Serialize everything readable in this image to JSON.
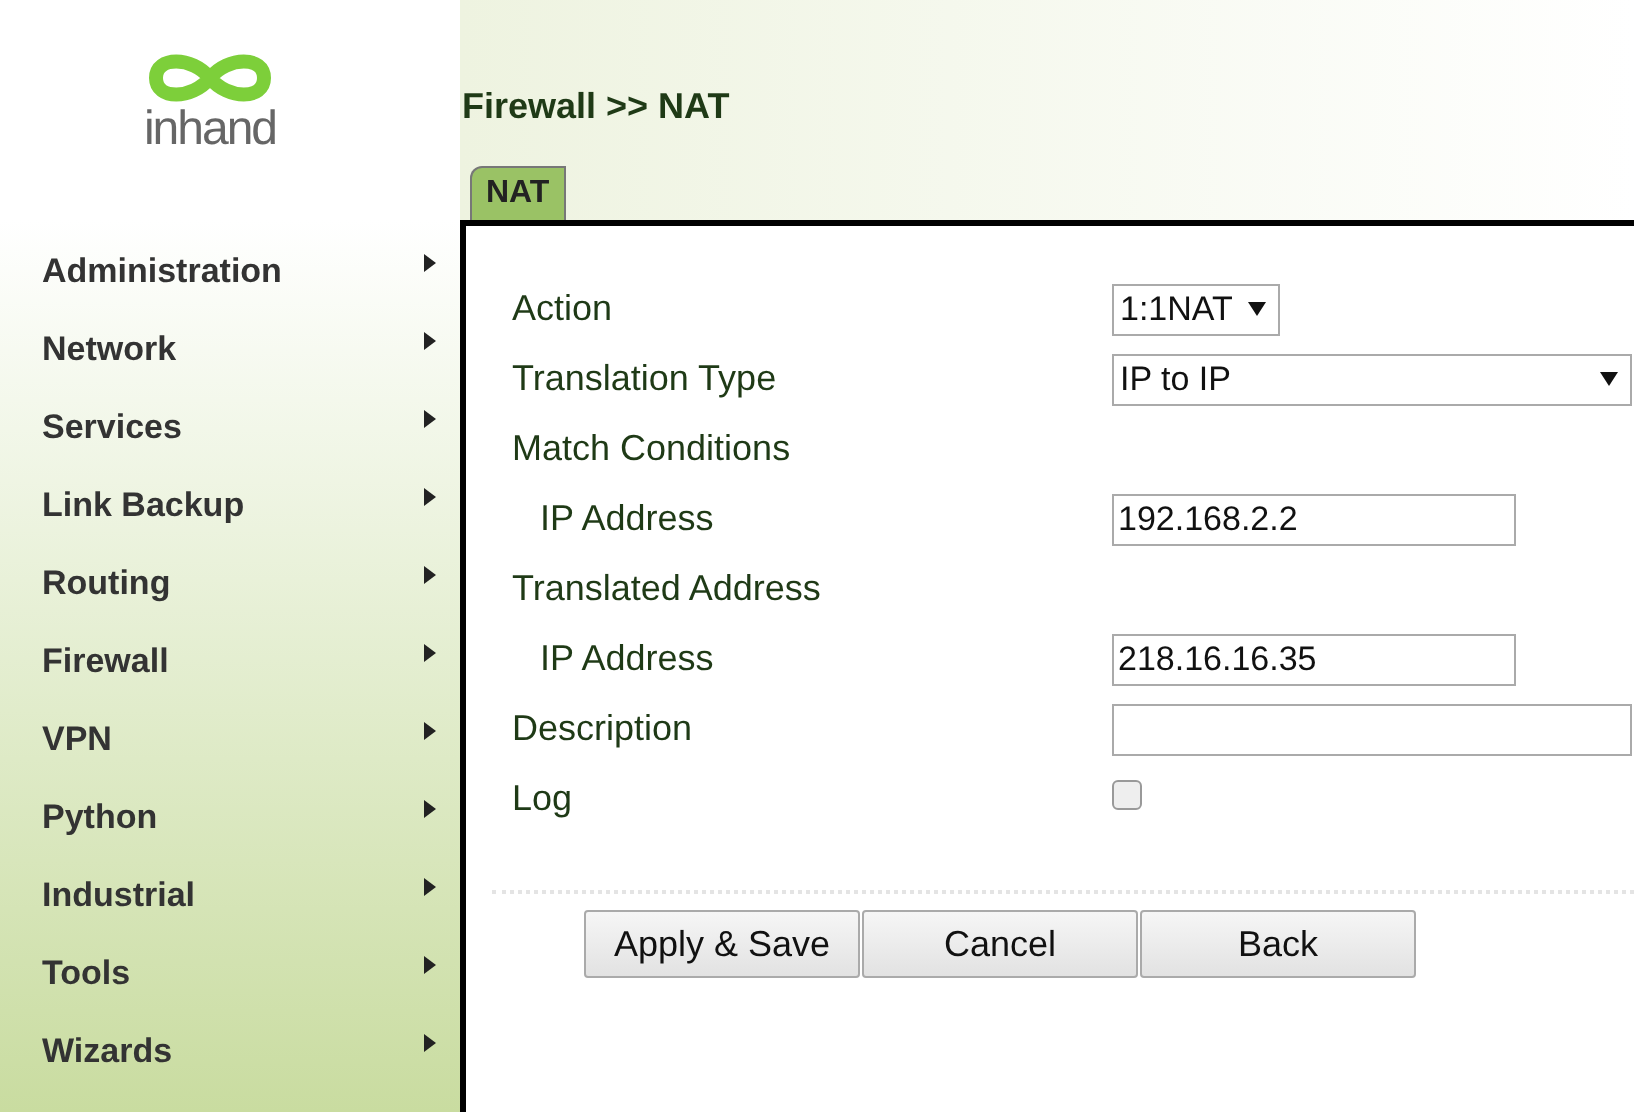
{
  "logo": {
    "text": "inhand"
  },
  "sidebar": {
    "items": [
      {
        "label": "Administration"
      },
      {
        "label": "Network"
      },
      {
        "label": "Services"
      },
      {
        "label": "Link Backup"
      },
      {
        "label": "Routing"
      },
      {
        "label": "Firewall"
      },
      {
        "label": "VPN"
      },
      {
        "label": "Python"
      },
      {
        "label": "Industrial"
      },
      {
        "label": "Tools"
      },
      {
        "label": "Wizards"
      }
    ]
  },
  "page_title": "Firewall >> NAT",
  "tabs": [
    {
      "label": "NAT",
      "selected": true
    }
  ],
  "form": {
    "rows": [
      {
        "kind": "select",
        "label": "Action",
        "value": "1:1NAT"
      },
      {
        "kind": "wide-select",
        "label": "Translation Type",
        "value": "IP to IP"
      },
      {
        "kind": "heading",
        "label": "Match Conditions"
      },
      {
        "kind": "text",
        "label": "IP Address",
        "value": "192.168.2.2",
        "indented": true
      },
      {
        "kind": "heading",
        "label": "Translated Address"
      },
      {
        "kind": "text",
        "label": "IP Address",
        "value": "218.16.16.35",
        "indented": true
      },
      {
        "kind": "wide-text",
        "label": "Description",
        "value": ""
      },
      {
        "kind": "checkbox",
        "label": "Log",
        "checked": false
      }
    ]
  },
  "buttons": [
    "Apply & Save",
    "Cancel",
    "Back"
  ]
}
